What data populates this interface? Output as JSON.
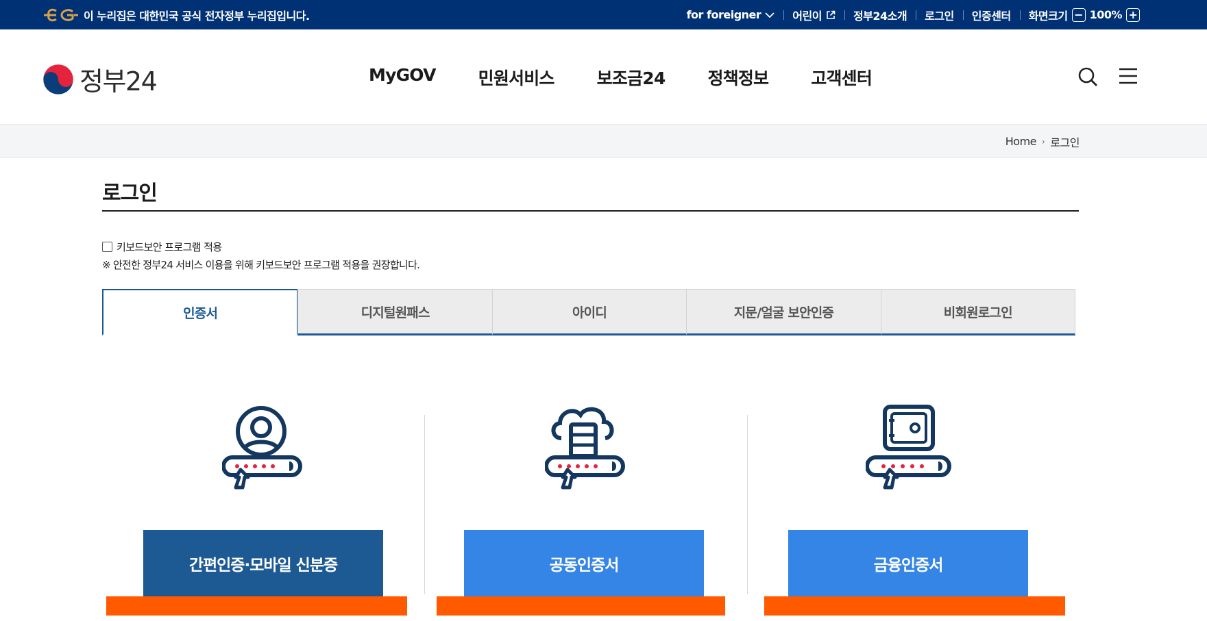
{
  "topbar": {
    "official_text": "이 누리집은 대한민국 공식 전자정부 누리집입니다.",
    "links": {
      "foreigner": "for foreigner",
      "kids": "어린이",
      "about": "정부24소개",
      "login": "로그인",
      "cert_center": "인증센터",
      "zoom_label": "화면크기",
      "zoom_value": "100%"
    }
  },
  "header": {
    "logo_text": "정부24",
    "nav": [
      "MyGOV",
      "민원서비스",
      "보조금24",
      "정책정보",
      "고객센터"
    ]
  },
  "breadcrumb": {
    "home": "Home",
    "current": "로그인"
  },
  "page": {
    "title": "로그인",
    "keyboard_security_label": "키보드보안 프로그램 적용",
    "keyboard_security_checked": false,
    "notice": "※ 안전한 정부24 서비스 이용을 위해 키보드보안 프로그램 적용을 권장합니다."
  },
  "tabs": [
    {
      "label": "인증서",
      "active": true
    },
    {
      "label": "디지털원패스",
      "active": false
    },
    {
      "label": "아이디",
      "active": false
    },
    {
      "label": "지문/얼굴 보안인증",
      "active": false
    },
    {
      "label": "비회원로그인",
      "active": false
    }
  ],
  "methods": [
    {
      "icon": "person-password-icon",
      "label": "간편인증·모바일 신분증",
      "color": "#1d5a94"
    },
    {
      "icon": "cloud-server-password-icon",
      "label": "공동인증서",
      "color": "#3585e6"
    },
    {
      "icon": "safe-password-icon",
      "label": "금융인증서",
      "color": "#3585e6"
    }
  ],
  "colors": {
    "topbar_bg": "#003175",
    "primary": "#1d5a94",
    "button_light": "#3585e6",
    "highlight": "#ff5a00",
    "icon_accent": "#e5233d"
  }
}
